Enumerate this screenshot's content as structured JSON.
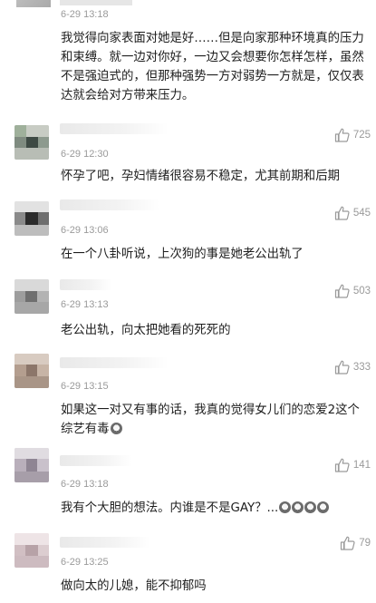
{
  "comments": [
    {
      "time": "6-29 13:18",
      "text": "我觉得向家表面对她是好……但是向家那种环境真的压力和束缚。就一边对你好，一边又会想要你怎样怎样，虽然不是强迫式的，但那种强势一方对弱势一方就是，仅仅表达就会给对方带来压力。",
      "likes": "",
      "emoji_count": 0
    },
    {
      "time": "6-29 12:30",
      "text": "怀孕了吧，孕妇情绪很容易不稳定，尤其前期和后期",
      "likes": "725",
      "emoji_count": 0
    },
    {
      "time": "6-29 13:06",
      "text": "在一个八卦听说，上次狗的事是她老公出轨了",
      "likes": "545",
      "emoji_count": 0
    },
    {
      "time": "6-29 13:13",
      "text": "老公出轨，向太把她看的死死的",
      "likes": "503",
      "emoji_count": 0
    },
    {
      "time": "6-29 13:15",
      "text": "如果这一对又有事的话，我真的觉得女儿们的恋爱2这个综艺有毒",
      "likes": "333",
      "emoji_count": 1
    },
    {
      "time": "6-29 13:18",
      "text": "我有个大胆的想法。内谁是不是GAY？...",
      "likes": "141",
      "emoji_count": 4
    },
    {
      "time": "6-29 13:25",
      "text": "做向太的儿媳，能不抑郁吗",
      "likes": "79",
      "emoji_count": 0
    }
  ],
  "icons": {
    "like": "thumbs-up-outline-icon",
    "emoji": "cry-laugh-emoji-icon"
  },
  "colors": {
    "text": "#1e1e1e",
    "meta": "#9a9a9a",
    "background": "#ffffff"
  }
}
